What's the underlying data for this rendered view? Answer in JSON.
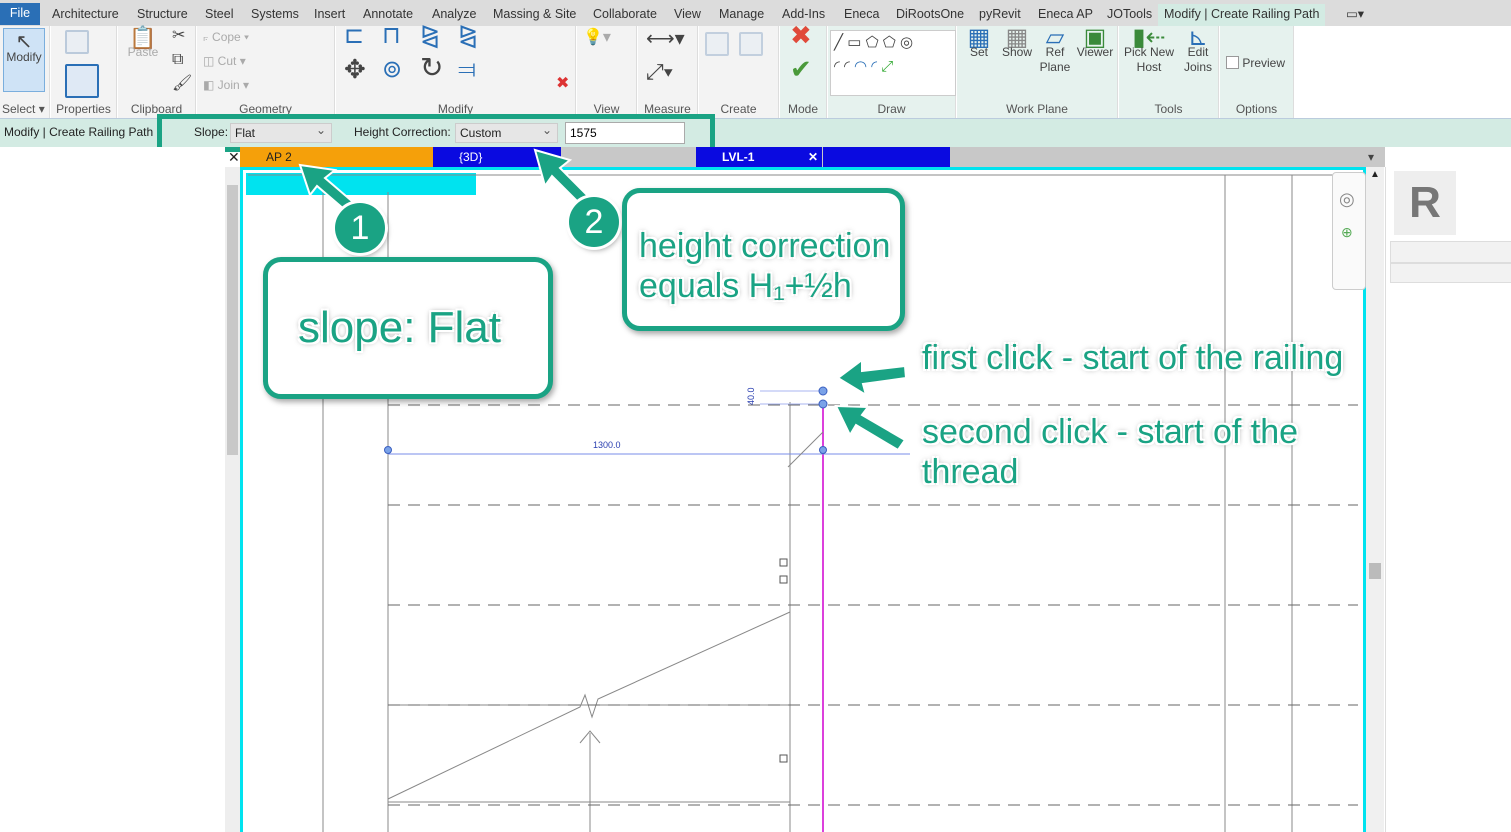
{
  "ribbon_tabs": [
    "File",
    "Architecture",
    "Structure",
    "Steel",
    "Systems",
    "Insert",
    "Annotate",
    "Analyze",
    "Massing & Site",
    "Collaborate",
    "View",
    "Manage",
    "Add-Ins",
    "Eneca",
    "DiRootsOne",
    "pyRevit",
    "Eneca AP",
    "JOTools",
    "Modify | Create Railing Path"
  ],
  "active_tab": "Modify | Create Railing Path",
  "panels": {
    "select": {
      "label": "Select",
      "modify": "Modify"
    },
    "properties": {
      "label": "Properties"
    },
    "clipboard": {
      "label": "Clipboard",
      "paste": "Paste"
    },
    "geometry": {
      "label": "Geometry",
      "cope": "Cope",
      "cut": "Cut",
      "join": "Join"
    },
    "modify": {
      "label": "Modify"
    },
    "view": {
      "label": "View"
    },
    "measure": {
      "label": "Measure"
    },
    "create": {
      "label": "Create"
    },
    "mode": {
      "label": "Mode"
    },
    "draw": {
      "label": "Draw"
    },
    "work_plane": {
      "label": "Work Plane",
      "set": "Set",
      "show": "Show",
      "ref_plane": "Ref Plane",
      "viewer": "Viewer"
    },
    "tools": {
      "label": "Tools",
      "pick_new_host": "Pick New Host",
      "edit_joins": "Edit Joins"
    },
    "options": {
      "label": "Options",
      "preview": "Preview",
      "preview_checked": false
    }
  },
  "options_bar": {
    "context": "Modify | Create Railing Path",
    "slope_label": "Slope:",
    "slope_value": "Flat",
    "height_label": "Height Correction:",
    "height_value": "Custom",
    "height_input": "1575"
  },
  "view_tabs": [
    {
      "label": "AP 2",
      "color": "#f5a00a"
    },
    {
      "label": "{3D}",
      "color": "#0a0ae0"
    },
    {
      "label": "",
      "color": "#c8c8c8"
    },
    {
      "label": "LVL-1",
      "color": "#0a0ae0"
    },
    {
      "label": "",
      "color": "#0a0ae0"
    }
  ],
  "drawing": {
    "dimension_main": "1300.0",
    "dimension_small": "40.0"
  },
  "annotations": {
    "num1": "1",
    "num2": "2",
    "slope_note": "slope: Flat",
    "height_note_1": "height correction",
    "height_note_2": "equals H₁+½h",
    "first_click": "first click - start of the railing",
    "second_click_1": "second click - start of the",
    "second_click_2": "thread",
    "accent": "#1aa384"
  }
}
